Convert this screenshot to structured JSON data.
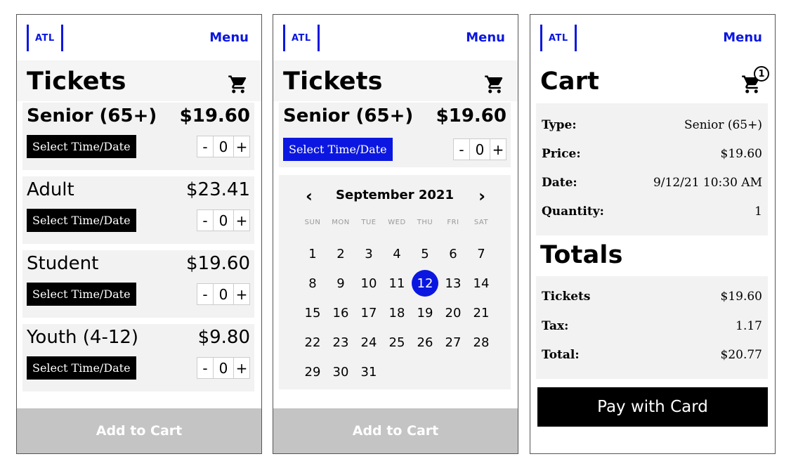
{
  "brand": {
    "logo_text": "ATL",
    "menu_label": "Menu",
    "accent": "#0b17e0"
  },
  "screens": [
    {
      "title": "Tickets",
      "tickets": [
        {
          "name": "Senior (65+)",
          "price": "$19.60",
          "select_label": "Select Time/Date",
          "qty": "0",
          "minus": "-",
          "plus": "+"
        },
        {
          "name": "Adult",
          "price": "$23.41",
          "select_label": "Select Time/Date",
          "qty": "0",
          "minus": "-",
          "plus": "+"
        },
        {
          "name": "Student",
          "price": "$19.60",
          "select_label": "Select Time/Date",
          "qty": "0",
          "minus": "-",
          "plus": "+"
        },
        {
          "name": "Youth (4-12)",
          "price": "$9.80",
          "select_label": "Select Time/Date",
          "qty": "0",
          "minus": "-",
          "plus": "+"
        }
      ],
      "add_to_cart": "Add to Cart"
    },
    {
      "title": "Tickets",
      "ticket": {
        "name": "Senior (65+)",
        "price": "$19.60",
        "select_label": "Select Time/Date",
        "qty": "0",
        "minus": "-",
        "plus": "+"
      },
      "calendar": {
        "month_label": "September 2021",
        "prev": "‹",
        "next": "›",
        "weekdays": [
          "SUN",
          "MON",
          "TUE",
          "WED",
          "THU",
          "FRI",
          "SAT"
        ],
        "weeks": [
          [
            "1",
            "2",
            "3",
            "4",
            "5",
            "6",
            "7"
          ],
          [
            "8",
            "9",
            "10",
            "11",
            "12",
            "13",
            "14"
          ],
          [
            "15",
            "16",
            "17",
            "18",
            "19",
            "20",
            "21"
          ],
          [
            "22",
            "23",
            "24",
            "25",
            "26",
            "27",
            "28"
          ],
          [
            "29",
            "30",
            "31",
            "",
            "",
            "",
            ""
          ]
        ],
        "selected_day": "12"
      },
      "add_to_cart": "Add to Cart"
    },
    {
      "title": "Cart",
      "cart_badge": "1",
      "details": [
        {
          "label": "Type:",
          "value": "Senior (65+)"
        },
        {
          "label": "Price:",
          "value": "$19.60"
        },
        {
          "label": "Date:",
          "value": "9/12/21 10:30 AM"
        },
        {
          "label": "Quantity:",
          "value": "1"
        }
      ],
      "totals_title": "Totals",
      "totals": [
        {
          "label": "Tickets",
          "value": "$19.60"
        },
        {
          "label": "Tax:",
          "value": "1.17"
        },
        {
          "label": "Total:",
          "value": "$20.77"
        }
      ],
      "pay_label": "Pay with Card"
    }
  ]
}
